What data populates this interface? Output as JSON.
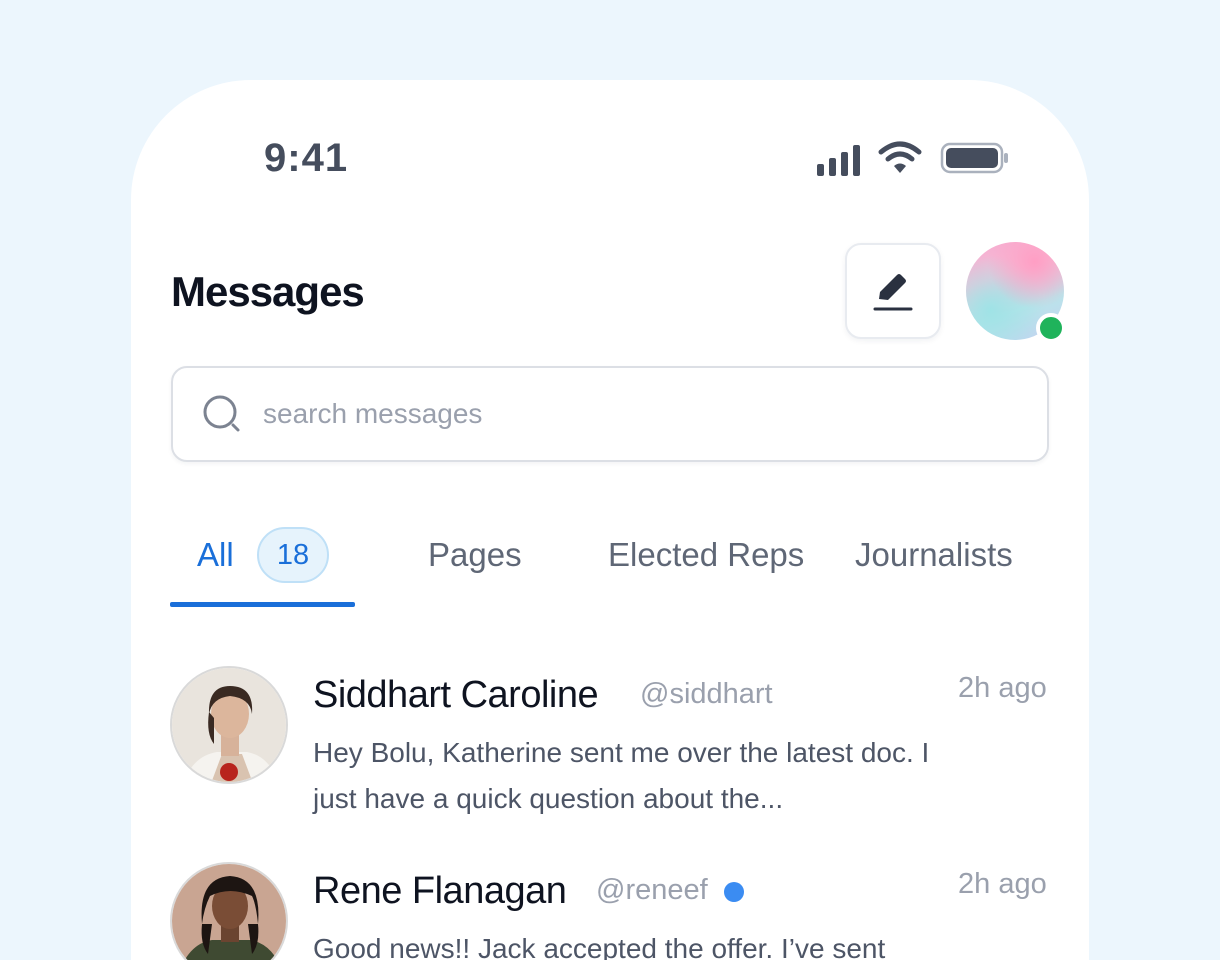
{
  "status_bar": {
    "time": "9:41"
  },
  "header": {
    "title": "Messages"
  },
  "search": {
    "placeholder": "search messages"
  },
  "tabs": [
    {
      "label": "All",
      "badge": "18",
      "active": true
    },
    {
      "label": "Pages"
    },
    {
      "label": "Elected Reps"
    },
    {
      "label": "Journalists"
    }
  ],
  "messages": [
    {
      "name": "Siddhart Caroline",
      "handle": "@siddhart",
      "time": "2h ago",
      "preview": "Hey Bolu, Katherine sent me over the latest doc. I just have a quick question about the...",
      "unread": false
    },
    {
      "name": "Rene Flanagan",
      "handle": "@reneef",
      "time": "2h ago",
      "preview": "Good news!! Jack accepted the offer. I’ve sent",
      "unread": true
    }
  ],
  "colors": {
    "accent": "#1a6fd9",
    "online": "#1fb35b",
    "unread": "#3b8cf2",
    "background": "#ecf6fd"
  }
}
